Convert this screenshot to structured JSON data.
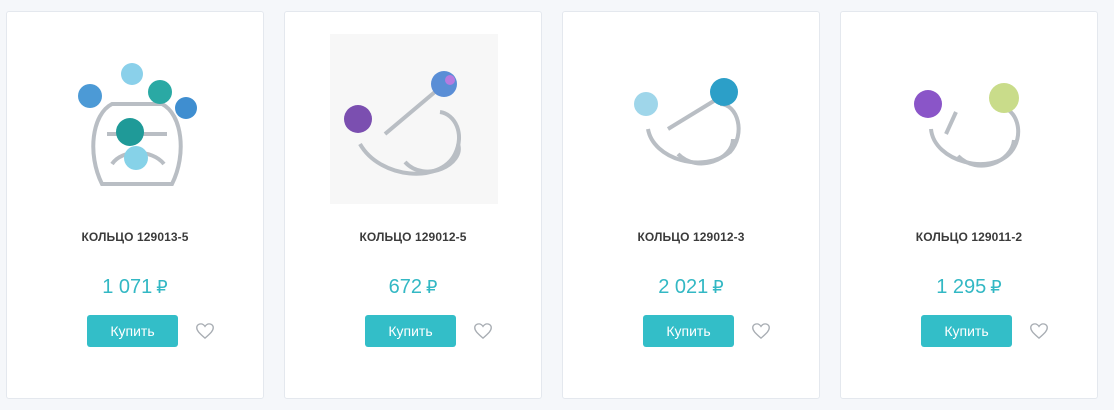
{
  "products": [
    {
      "title": "КОЛЬЦО 129013-5",
      "price": "1 071",
      "currency": "₽",
      "buy_label": "Купить",
      "image_icon": "ring-image",
      "stone_colors": [
        "#2aa9a4",
        "#5cc3e6",
        "#1f8fb0",
        "#7fd4e8"
      ]
    },
    {
      "title": "КОЛЬЦО 129012-5",
      "price": "672",
      "currency": "₽",
      "buy_label": "Купить",
      "image_icon": "ring-image",
      "stone_colors": [
        "#7b4fb0",
        "#5a8ed6"
      ]
    },
    {
      "title": "КОЛЬЦО 129012-3",
      "price": "2 021",
      "currency": "₽",
      "buy_label": "Купить",
      "image_icon": "ring-image",
      "stone_colors": [
        "#9fd6ea",
        "#2c9fc8"
      ]
    },
    {
      "title": "КОЛЬЦО 129011-2",
      "price": "1 295",
      "currency": "₽",
      "buy_label": "Купить",
      "image_icon": "ring-image",
      "stone_colors": [
        "#8a55c8",
        "#c9dc8a"
      ]
    }
  ],
  "colors": {
    "accent": "#33bec8",
    "price": "#33b8c4",
    "title": "#3b3b3b"
  },
  "icons": {
    "favorite": "heart-outline-icon"
  }
}
